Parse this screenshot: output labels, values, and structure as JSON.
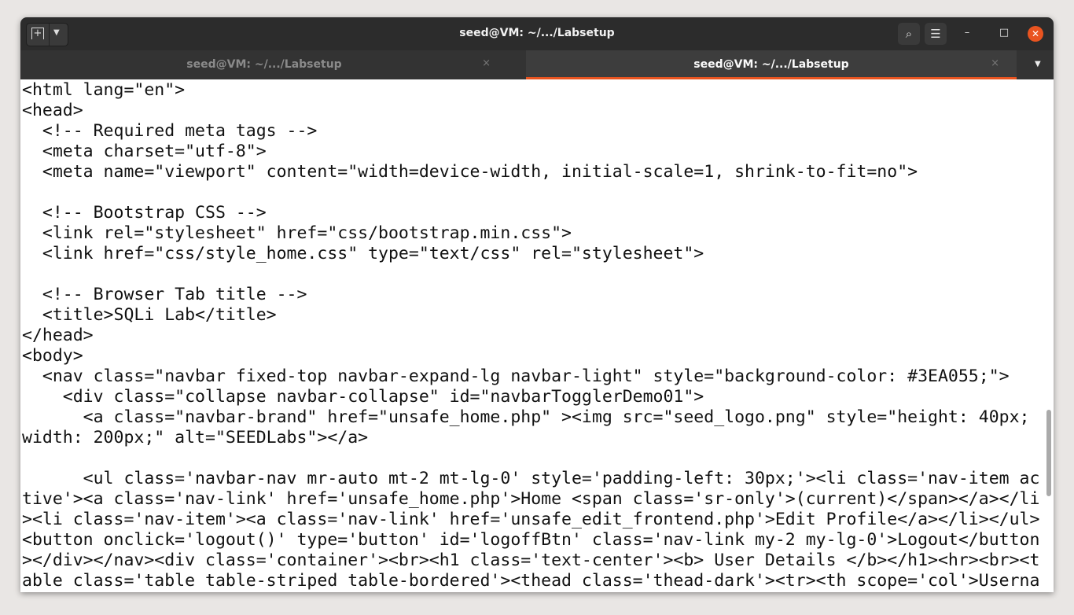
{
  "window": {
    "title": "seed@VM: ~/.../Labsetup"
  },
  "tabs": [
    {
      "label": "seed@VM: ~/.../Labsetup",
      "active": false
    },
    {
      "label": "seed@VM: ~/.../Labsetup",
      "active": true
    }
  ],
  "icons": {
    "new_tab": "+",
    "dropdown": "▼",
    "search": "⌕",
    "menu": "☰",
    "minimize": "–",
    "maximize": "□",
    "close": "✕",
    "tab_close": "×"
  },
  "colors": {
    "accent": "#e95420",
    "titlebar": "#2c2c2c"
  },
  "terminal": {
    "lines": [
      "<html lang=\"en\">",
      "<head>",
      "  <!-- Required meta tags -->",
      "  <meta charset=\"utf-8\">",
      "  <meta name=\"viewport\" content=\"width=device-width, initial-scale=1, shrink-to-fit=no\">",
      "",
      "  <!-- Bootstrap CSS -->",
      "  <link rel=\"stylesheet\" href=\"css/bootstrap.min.css\">",
      "  <link href=\"css/style_home.css\" type=\"text/css\" rel=\"stylesheet\">",
      "",
      "  <!-- Browser Tab title -->",
      "  <title>SQLi Lab</title>",
      "</head>",
      "<body>",
      "  <nav class=\"navbar fixed-top navbar-expand-lg navbar-light\" style=\"background-color: #3EA055;\">",
      "    <div class=\"collapse navbar-collapse\" id=\"navbarTogglerDemo01\">",
      "      <a class=\"navbar-brand\" href=\"unsafe_home.php\" ><img src=\"seed_logo.png\" style=\"height: 40px;",
      "width: 200px;\" alt=\"SEEDLabs\"></a>",
      "",
      "      <ul class='navbar-nav mr-auto mt-2 mt-lg-0' style='padding-left: 30px;'><li class='nav-item ac",
      "tive'><a class='nav-link' href='unsafe_home.php'>Home <span class='sr-only'>(current)</span></a></li",
      "><li class='nav-item'><a class='nav-link' href='unsafe_edit_frontend.php'>Edit Profile</a></li></ul>",
      "<button onclick='logout()' type='button' id='logoffBtn' class='nav-link my-2 my-lg-0'>Logout</button",
      "></div></nav><div class='container'><br><h1 class='text-center'><b> User Details </b></h1><hr><br><t",
      "able class='table table-striped table-bordered'><thead class='thead-dark'><tr><th scope='col'>Userna"
    ]
  }
}
